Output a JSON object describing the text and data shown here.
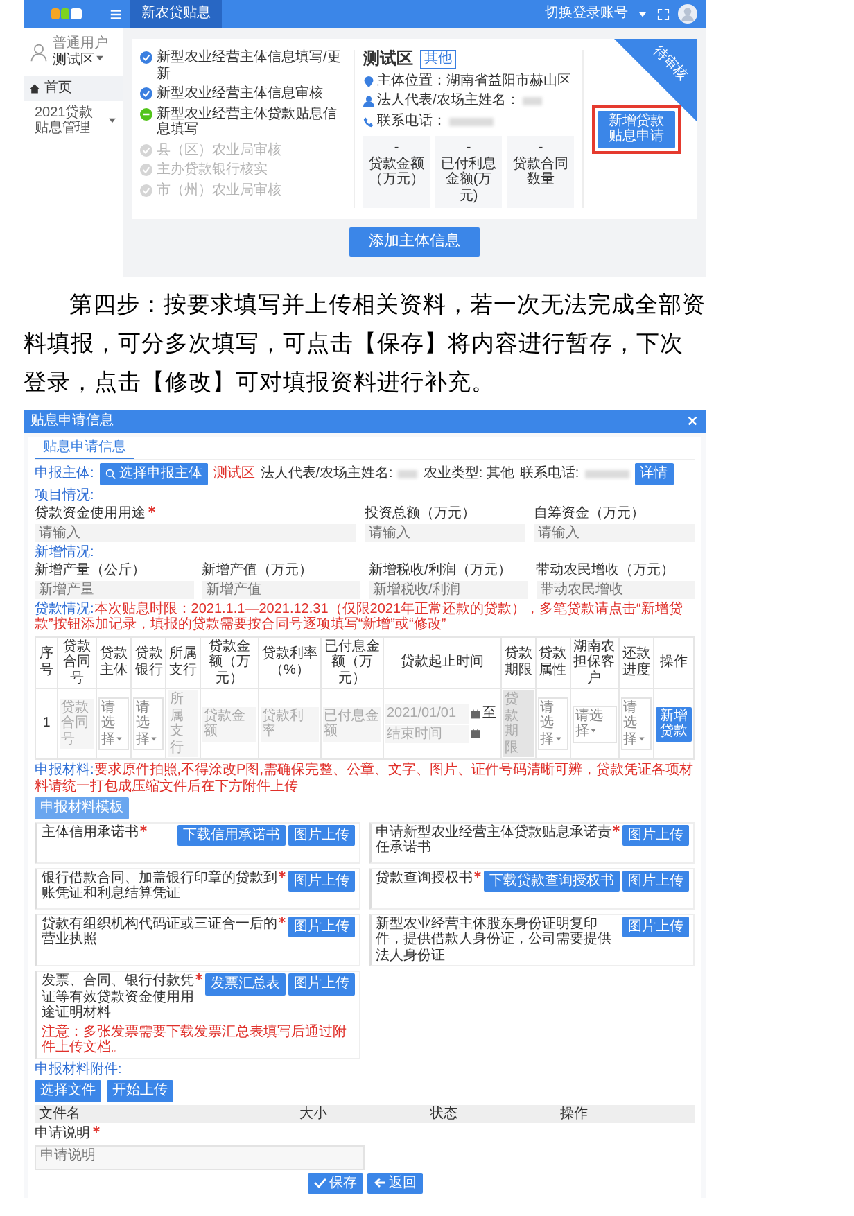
{
  "top_screenshot": {
    "header": {
      "tab": {
        "label": "新农贷贴息",
        "selected": true
      },
      "account_menu": "切换登录账号"
    },
    "sidebar": {
      "user_role": "普通用户",
      "user_area": "测试区",
      "items": [
        {
          "label": "首页",
          "kind": "home"
        },
        {
          "label": "2021贷款贴息管理",
          "kind": "group"
        }
      ]
    },
    "steps": [
      {
        "label": "新型农业经营主体信息填写/更新",
        "kind": "done"
      },
      {
        "label": "新型农业经营主体信息审核",
        "kind": "done"
      },
      {
        "label": "新型农业经营主体贷款贴息信息填写",
        "kind": "current"
      },
      {
        "label": "县（区）农业局审核",
        "kind": "pending"
      },
      {
        "label": "主办贷款银行核实",
        "kind": "pending"
      },
      {
        "label": "市（州）农业局审核",
        "kind": "pending"
      }
    ],
    "entity": {
      "name": "测试区",
      "tag": "其他",
      "location_label": "主体位置：",
      "location": "湖南省益阳市赫山区",
      "rep_label": "法人代表/农场主姓名：",
      "phone_label": "联系电话："
    },
    "stats": [
      {
        "value": "-",
        "label": "贷款金额（万元）"
      },
      {
        "value": "-",
        "label": "已付利息金额(万元)"
      },
      {
        "value": "-",
        "label": "贷款合同数量"
      }
    ],
    "apply_button": "新增贷款贴息申请",
    "corner_badge": "待审核",
    "add_button": "添加主体信息"
  },
  "instruction": "第四步：按要求填写并上传相关资料，若一次无法完成全部资料填报，可分多次填写，可点击【保存】将内容进行暂存，下次登录，点击【修改】可对填报资料进行补充。",
  "form": {
    "title": "贴息申请信息",
    "tabs": [
      {
        "label": "贴息申请信息",
        "selected": true
      }
    ],
    "applicant": {
      "label": "申报主体:",
      "select_button": "选择申报主体",
      "name": "测试区",
      "rep_label": "法人代表/农场主姓名:",
      "type_label": "农业类型:",
      "type": "其他",
      "phone_label": "联系电话:",
      "detail_button": "详情"
    },
    "project": {
      "heading": "项目情况:",
      "fields": [
        {
          "label": "贷款资金使用用途",
          "required": true,
          "placeholder": "请输入"
        },
        {
          "label": "投资总额（万元）",
          "required": false,
          "placeholder": "请输入"
        },
        {
          "label": "自筹资金（万元）",
          "required": false,
          "placeholder": "请输入"
        }
      ]
    },
    "increase": {
      "heading": "新增情况:",
      "fields": [
        {
          "label": "新增产量（公斤）",
          "required": false,
          "placeholder": "新增产量"
        },
        {
          "label": "新增产值（万元）",
          "required": false,
          "placeholder": "新增产值"
        },
        {
          "label": "新增税收/利润（万元）",
          "required": false,
          "placeholder": "新增税收/利润"
        },
        {
          "label": "带动农民增收（万元）",
          "required": false,
          "placeholder": "带动农民增收"
        }
      ]
    },
    "loan": {
      "heading": "贷款情况:",
      "note": "本次贴息时限：2021.1.1—2021.12.31（仅限2021年正常还款的贷款），多笔贷款请点击“新增贷款”按钮添加记录，填报的贷款需要按合同号逐项填写“新增”或“修改”",
      "columns": [
        "序号",
        "贷款合同号",
        "贷款主体",
        "贷款银行",
        "所属支行",
        "贷款金额（万元）",
        "贷款利率（%）",
        "已付息金额（万元）",
        "贷款起止时间",
        "贷款期限",
        "贷款属性",
        "湖南农担保客户",
        "还款进度",
        "操作"
      ],
      "rows": [
        {
          "cells": [
            {
              "kind": "text",
              "value": "1"
            },
            {
              "kind": "input",
              "placeholder": "贷款合同号",
              "disabled": false
            },
            {
              "kind": "select",
              "placeholder": "请选择"
            },
            {
              "kind": "select",
              "placeholder": "请选择"
            },
            {
              "kind": "input",
              "placeholder": "所属支行",
              "disabled": false
            },
            {
              "kind": "input",
              "placeholder": "贷款金额",
              "disabled": false
            },
            {
              "kind": "input",
              "placeholder": "贷款利率",
              "disabled": false
            },
            {
              "kind": "input",
              "placeholder": "已付息金额",
              "disabled": false
            },
            {
              "kind": "daterange",
              "start": "2021/01/01",
              "separator": "至",
              "end_placeholder": "结束时间"
            },
            {
              "kind": "input",
              "placeholder": "贷款期限",
              "disabled": true
            },
            {
              "kind": "select",
              "placeholder": "请选择"
            },
            {
              "kind": "select",
              "placeholder": "请选择"
            },
            {
              "kind": "select",
              "placeholder": "请选择"
            },
            {
              "kind": "button",
              "label": "新增贷款"
            }
          ]
        }
      ]
    },
    "materials": {
      "heading": "申报材料:",
      "note": "要求原件拍照,不得涂改P图,需确保完整、公章、文字、图片、证件号码清晰可辨，贷款凭证各项材料请统一打包成压缩文件后在下方附件上传",
      "template_button": "申报材料模板",
      "panels": [
        {
          "title": "主体信用承诺书",
          "required": true,
          "buttons": [
            "下载信用承诺书",
            "图片上传"
          ]
        },
        {
          "title": "申请新型农业经营主体贷款贴息承诺责任承诺书",
          "required": true,
          "buttons": [
            "图片上传"
          ]
        },
        {
          "title": "银行借款合同、加盖银行印章的贷款到账凭证和利息结算凭证",
          "required": true,
          "buttons": [
            "图片上传"
          ]
        },
        {
          "title": "贷款查询授权书",
          "required": true,
          "buttons": [
            "下载贷款查询授权书",
            "图片上传"
          ]
        },
        {
          "title": "贷款有组织机构代码证或三证合一后的营业执照",
          "required": true,
          "buttons": [
            "图片上传"
          ]
        },
        {
          "title": "新型农业经营主体股东身份证明复印件，提供借款人身份证，公司需要提供法人身份证",
          "required": false,
          "buttons": [
            "图片上传"
          ]
        },
        {
          "title": "发票、合同、银行付款凭证等有效贷款资金使用用途证明材料",
          "required": true,
          "buttons": [
            "发票汇总表",
            "图片上传"
          ],
          "note": "注意：多张发票需要下载发票汇总表填写后通过附件上传文档。"
        }
      ]
    },
    "attachments": {
      "heading": "申报材料附件:",
      "buttons": [
        "选择文件",
        "开始上传"
      ],
      "columns": [
        "文件名",
        "大小",
        "状态",
        "操作"
      ]
    },
    "description": {
      "label": "申请说明",
      "required": true,
      "placeholder": "申请说明"
    },
    "footer_buttons": [
      {
        "label": "保存",
        "kind": "save"
      },
      {
        "label": "返回",
        "kind": "back"
      }
    ]
  }
}
